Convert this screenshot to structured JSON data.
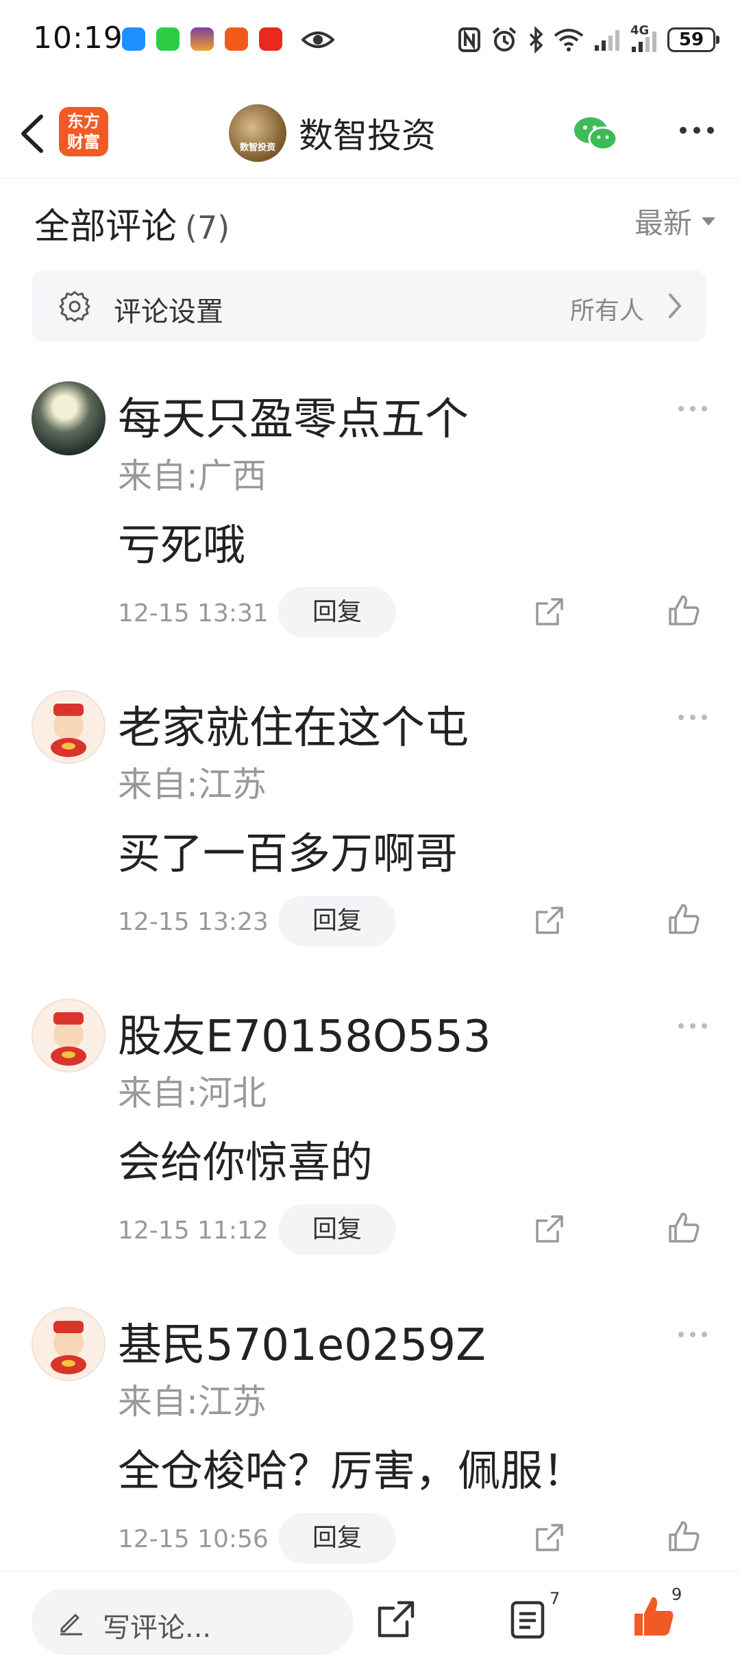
{
  "status_bar": {
    "time": "10:19",
    "battery": "59",
    "network": "4G",
    "icons": [
      "messages-app-icon",
      "wechat-app-icon",
      "app-icon",
      "app-icon",
      "app-icon",
      "eye-icon",
      "nfc-icon",
      "alarm-icon",
      "bluetooth-icon",
      "wifi-icon",
      "signal-icon",
      "signal-icon"
    ]
  },
  "header": {
    "logo_line1": "东方",
    "logo_line2": "财富",
    "account_avatar_text": "数智投资",
    "account_name": "数智投资"
  },
  "comments_section": {
    "title": "全部评论",
    "count": "(7)",
    "sort_label": "最新"
  },
  "settings": {
    "label": "评论设置",
    "value": "所有人"
  },
  "comments": [
    {
      "user": "每天只盈零点五个",
      "location": "来自:广西",
      "text": "亏死哦",
      "time": "12-15 13:31",
      "reply": "回复"
    },
    {
      "user": "老家就住在这个屯",
      "location": "来自:江苏",
      "text": "买了一百多万啊哥",
      "time": "12-15 13:23",
      "reply": "回复"
    },
    {
      "user": "股友E70158O553",
      "location": "来自:河北",
      "text": "会给你惊喜的",
      "time": "12-15 11:12",
      "reply": "回复"
    },
    {
      "user": "基民5701e0259Z",
      "location": "来自:江苏",
      "text": "全仓梭哈？厉害，佩服！",
      "time": "12-15 10:56",
      "reply": "回复"
    }
  ],
  "bottom_bar": {
    "write_placeholder": "写评论...",
    "comment_count": "7",
    "like_count": "9"
  },
  "colors": {
    "accent": "#f15a24",
    "like": "#f15a24",
    "wechat": "#3dbb56"
  }
}
